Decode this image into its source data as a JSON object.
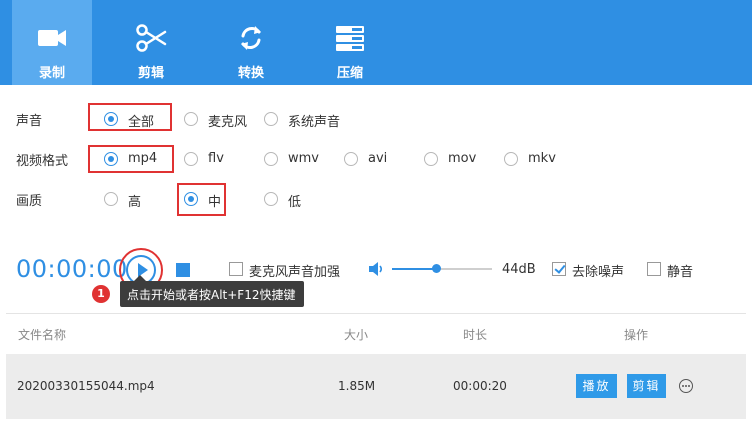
{
  "toolbar": {
    "tabs": [
      {
        "label": "录制",
        "icon": "video-camera-icon",
        "active": true
      },
      {
        "label": "剪辑",
        "icon": "scissors-icon",
        "active": false
      },
      {
        "label": "转换",
        "icon": "convert-icon",
        "active": false
      },
      {
        "label": "压缩",
        "icon": "compress-icon",
        "active": false
      }
    ]
  },
  "options": {
    "sound": {
      "label": "声音",
      "choices": [
        "全部",
        "麦克风",
        "系统声音"
      ],
      "selected": "全部"
    },
    "format": {
      "label": "视频格式",
      "choices": [
        "mp4",
        "flv",
        "wmv",
        "avi",
        "mov",
        "mkv"
      ],
      "selected": "mp4"
    },
    "quality": {
      "label": "画质",
      "choices": [
        "高",
        "中",
        "低"
      ],
      "selected": "中"
    }
  },
  "recorder": {
    "timer": "00:00:00",
    "mic_boost": {
      "label": "麦克风声音加强",
      "checked": false
    },
    "volume": {
      "value_label": "44dB",
      "level": 0.44
    },
    "denoise": {
      "label": "去除噪声",
      "checked": true
    },
    "mute": {
      "label": "静音",
      "checked": false
    }
  },
  "tooltip": {
    "badge": "1",
    "text": "点击开始或者按Alt+F12快捷键"
  },
  "files": {
    "columns": [
      "文件名称",
      "大小",
      "时长",
      "操作"
    ],
    "rows": [
      {
        "name": "20200330155044.mp4",
        "size": "1.85M",
        "duration": "00:00:20",
        "play_label": "播放",
        "edit_label": "剪辑"
      }
    ]
  },
  "colors": {
    "accent": "#2f8fe3",
    "highlight": "#e03232"
  }
}
